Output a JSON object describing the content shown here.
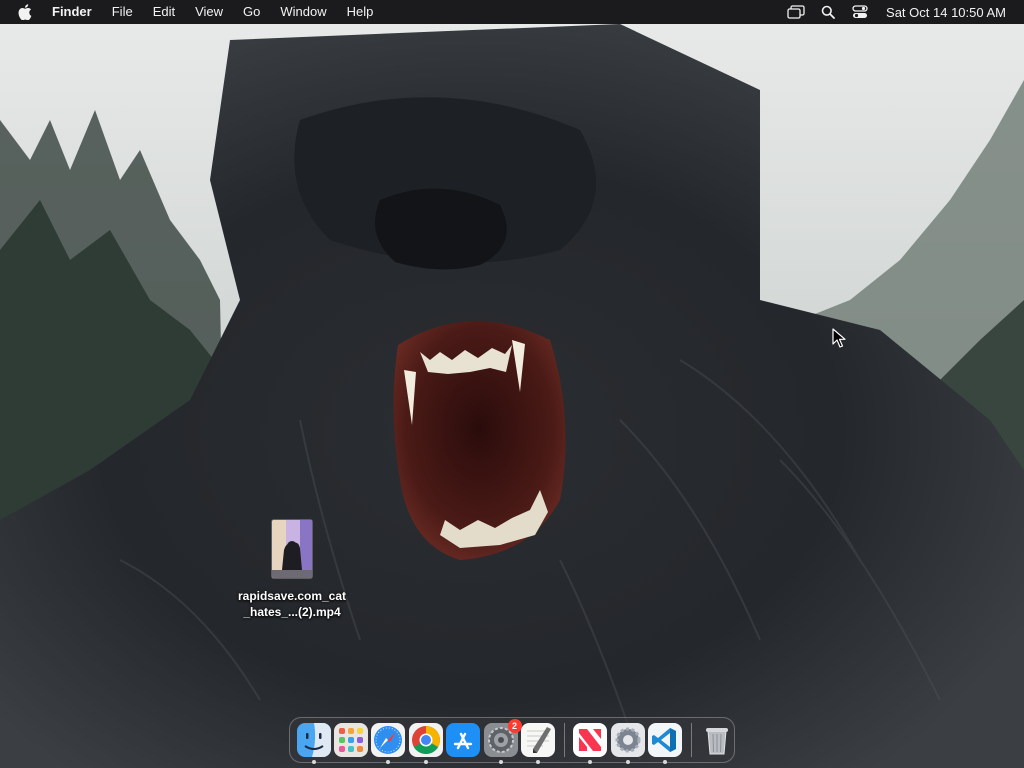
{
  "menubar": {
    "app_name": "Finder",
    "menus": [
      "File",
      "Edit",
      "View",
      "Go",
      "Window",
      "Help"
    ],
    "datetime": "Sat Oct 14  10:50 AM",
    "status_icons": [
      "screen-mirroring-icon",
      "spotlight-search-icon",
      "control-center-icon"
    ]
  },
  "desktop": {
    "file": {
      "name_line1": "rapidsave.com_cat",
      "name_line2": "_hates_...(2).mp4"
    }
  },
  "dock": {
    "apps": [
      {
        "name": "Finder",
        "icon": "finder-icon",
        "running": true
      },
      {
        "name": "Launchpad",
        "icon": "launchpad-icon",
        "running": false
      },
      {
        "name": "Safari",
        "icon": "safari-icon",
        "running": true
      },
      {
        "name": "Google Chrome",
        "icon": "chrome-icon",
        "running": true
      },
      {
        "name": "App Store",
        "icon": "app-store-icon",
        "running": false
      },
      {
        "name": "System Settings",
        "icon": "system-settings-icon",
        "running": true,
        "badge": "2"
      },
      {
        "name": "TextEdit",
        "icon": "textedit-icon",
        "running": true
      },
      {
        "name": "News",
        "icon": "news-icon",
        "running": true
      },
      {
        "name": "Settings Utility",
        "icon": "gear-app-icon",
        "running": false
      },
      {
        "name": "Visual Studio Code",
        "icon": "vscode-icon",
        "running": true
      },
      {
        "name": "Trash",
        "icon": "trash-icon",
        "running": false
      }
    ]
  },
  "colors": {
    "menubar_bg": "#1b1b1d",
    "badge_red": "#ff3b30"
  }
}
